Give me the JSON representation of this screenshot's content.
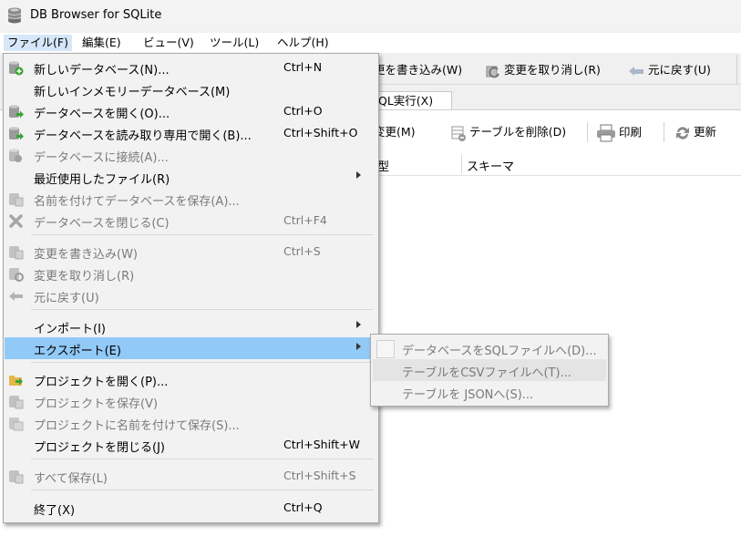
{
  "window": {
    "title": "DB Browser for SQLite",
    "accent": "#91c9f7"
  },
  "menubar": [
    {
      "label": "ファイル(F)",
      "active": true
    },
    {
      "label": "編集(E)"
    },
    {
      "label": "ビュー(V)"
    },
    {
      "label": "ツール(L)"
    },
    {
      "label": "ヘルプ(H)"
    }
  ],
  "toolbar": {
    "write_partial": "更を書き込み(W)",
    "revert": "変更を取り消し(R)",
    "undo": "元に戻す(U)"
  },
  "tabs": {
    "sql_partial": "QL実行(X)"
  },
  "toolbar2": {
    "modify_partial": "変更(M)",
    "delete_table": "テーブルを削除(D)",
    "print": "印刷",
    "refresh": "更新"
  },
  "table_header": {
    "type_partial": "型",
    "schema": "スキーマ"
  },
  "file_menu": {
    "new_db": {
      "label": "新しいデータベース(N)...",
      "shortcut": "Ctrl+N"
    },
    "new_mem_db": {
      "label": "新しいインメモリーデータベース(M)"
    },
    "open_db": {
      "label": "データベースを開く(O)...",
      "shortcut": "Ctrl+O"
    },
    "open_ro": {
      "label": "データベースを読み取り専用で開く(B)...",
      "shortcut": "Ctrl+Shift+O"
    },
    "connect": {
      "label": "データベースに接続(A)..."
    },
    "recent": {
      "label": "最近使用したファイル(R)"
    },
    "save_as": {
      "label": "名前を付けてデータベースを保存(A)..."
    },
    "close_db": {
      "label": "データベースを閉じる(C)",
      "shortcut": "Ctrl+F4"
    },
    "write_changes": {
      "label": "変更を書き込み(W)",
      "shortcut": "Ctrl+S"
    },
    "revert_changes": {
      "label": "変更を取り消し(R)"
    },
    "undo": {
      "label": "元に戻す(U)"
    },
    "import": {
      "label": "インポート(I)"
    },
    "export": {
      "label": "エクスポート(E)"
    },
    "open_project": {
      "label": "プロジェクトを開く(P)..."
    },
    "save_project": {
      "label": "プロジェクトを保存(V)"
    },
    "save_project_as": {
      "label": "プロジェクトに名前を付けて保存(S)..."
    },
    "close_project": {
      "label": "プロジェクトを閉じる(J)",
      "shortcut": "Ctrl+Shift+W"
    },
    "save_all": {
      "label": "すべて保存(L)",
      "shortcut": "Ctrl+Shift+S"
    },
    "exit": {
      "label": "終了(X)",
      "shortcut": "Ctrl+Q"
    }
  },
  "export_submenu": [
    {
      "label": "データベースをSQLファイルへ(D)..."
    },
    {
      "label": "テーブルをCSVファイルへ(T)..."
    },
    {
      "label": "テーブルを JSONへ(S)..."
    }
  ]
}
